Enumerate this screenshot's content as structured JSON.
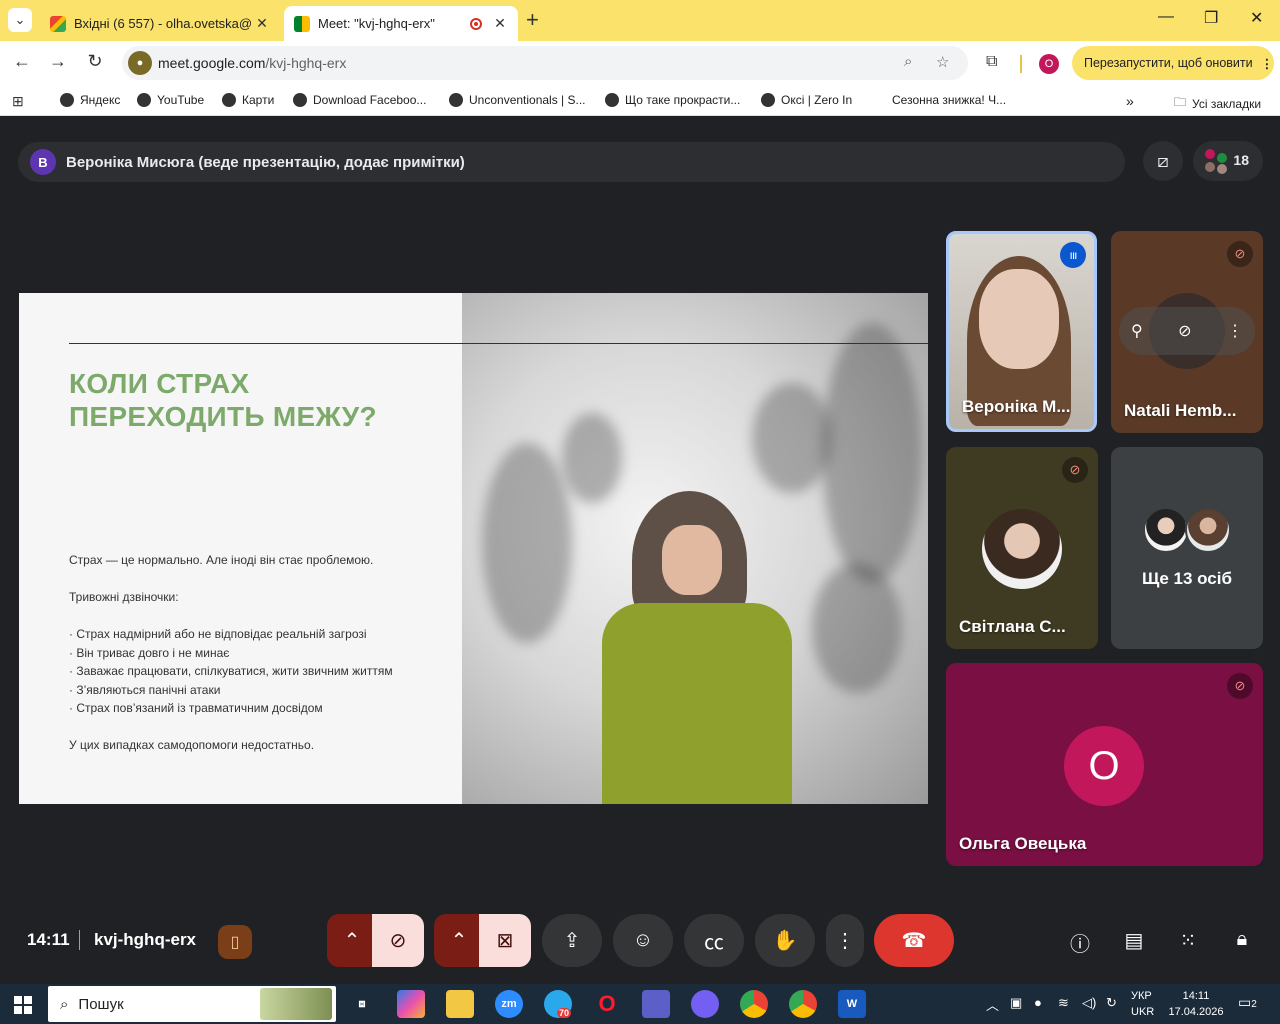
{
  "browser": {
    "tabs": [
      {
        "title": "Вхідні (6 557) - olha.ovetska@",
        "favicon": "gmail-icon",
        "active": false
      },
      {
        "title": "Meet: \"kvj-hghq-erx\"",
        "favicon": "meet-icon",
        "active": true
      }
    ],
    "url_host": "meet.google.com",
    "url_path": "/kvj-hghq-erx",
    "profile_initial": "O",
    "relaunch_label": "Перезапустити, щоб оновити",
    "bookmarks": [
      "Яндекс",
      "YouTube",
      "Карти",
      "Download Faceboo...",
      "Unconventionals | S...",
      "Що таке прокрасти...",
      "Оксі | Zero In",
      "Сезонна знижка! Ч..."
    ],
    "all_bookmarks_label": "Усі закладки"
  },
  "meet": {
    "presenter_initial": "В",
    "presenter_text": "Вероніка Мисюга (веде презентацію, додає примітки)",
    "participant_count": "18",
    "slide": {
      "title": "КОЛИ СТРАХ ПЕРЕХОДИТЬ МЕЖУ?",
      "intro": "Страх — це нормально. Але іноді він стає проблемою.",
      "warning_heading": "Тривожні дзвіночки:",
      "bullets": [
        "· Страх надмірний або не відповідає реальній загрозі",
        "· Він триває довго і не минає",
        "· Заважає працювати, спілкуватися, жити звичним життям",
        "· З’являються панічні атаки",
        "· Страх пов’язаний із травматичним досвідом"
      ],
      "conclusion": "У цих випадках самодопомоги недостатньо."
    },
    "tiles": {
      "veronika": "Вероніка М...",
      "natali": "Natali Hemb...",
      "svitlana": "Світлана С...",
      "more": "Ще 13 осіб",
      "olga": "Ольга Овецька",
      "olga_initial": "О"
    },
    "time": "14:11",
    "meeting_code": "kvj-hghq-erx",
    "colors": {
      "end_call": "#dc362e",
      "accent_blue": "#a8c7fa",
      "slide_title": "#7daa6a"
    }
  },
  "taskbar": {
    "search_label": "Пошук",
    "telegram_badge": "70",
    "lang_1": "УКР",
    "lang_2": "UKR",
    "clock_time": "14:11",
    "clock_date": "17.04.2026",
    "notifications": "2"
  }
}
